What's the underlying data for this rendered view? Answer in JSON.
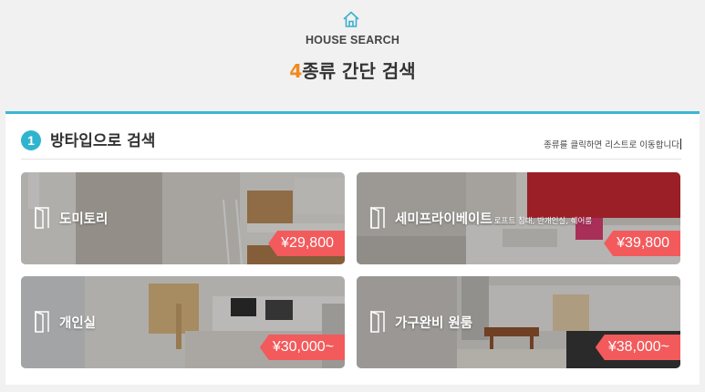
{
  "header": {
    "icon": "house-icon",
    "eyebrow": "HOUSE SEARCH",
    "title_number": "4",
    "title_text": "종류 간단 검색",
    "accent_color": "#f08a1e"
  },
  "section": {
    "step": "1",
    "title": "방타입으로 검색",
    "hint": "종류를 클릭하면 리스트로 이동합니다",
    "accent_color": "#2fb4cf"
  },
  "cards": [
    {
      "icon": "door-icon",
      "label": "도미토리",
      "sub": "",
      "price": "¥29,800"
    },
    {
      "icon": "door-icon",
      "label": "세미프라이베이트",
      "sub": "로프트 침대, 반개인실, 쉐어룸",
      "price": "¥39,800"
    },
    {
      "icon": "door-icon",
      "label": "개인실",
      "sub": "",
      "price": "¥30,000~"
    },
    {
      "icon": "door-icon",
      "label": "가구완비 원룸",
      "sub": "",
      "price": "¥38,000~"
    }
  ],
  "colors": {
    "price_tag": "#f25a5c",
    "panel_border": "#3cb8d0"
  }
}
